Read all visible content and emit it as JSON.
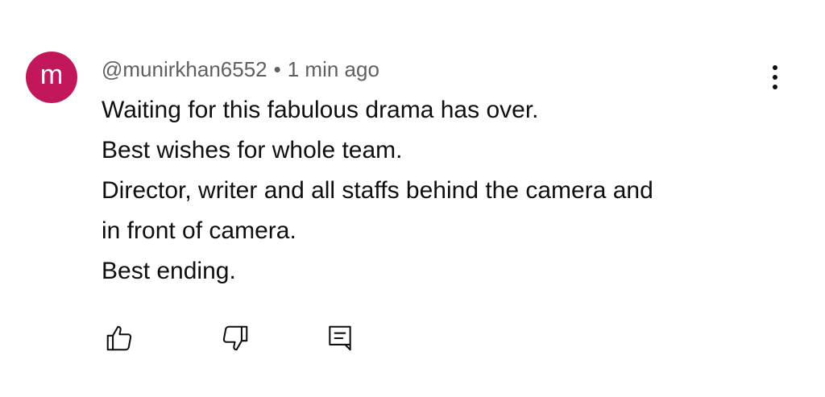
{
  "comment": {
    "avatar_letter": "m",
    "avatar_color": "#c2185b",
    "author": "@munirkhan6552",
    "separator": "•",
    "timestamp": "1 min ago",
    "lines": [
      "Waiting for this fabulous drama has over.",
      "Best wishes for whole team.",
      "Director, writer and all staffs behind the camera and",
      "in front of camera.",
      "Best ending."
    ]
  },
  "actions": {
    "like_icon": "thumbs-up-icon",
    "dislike_icon": "thumbs-down-icon",
    "reply_icon": "reply-comment-icon"
  },
  "menu_icon": "more-vertical-icon"
}
